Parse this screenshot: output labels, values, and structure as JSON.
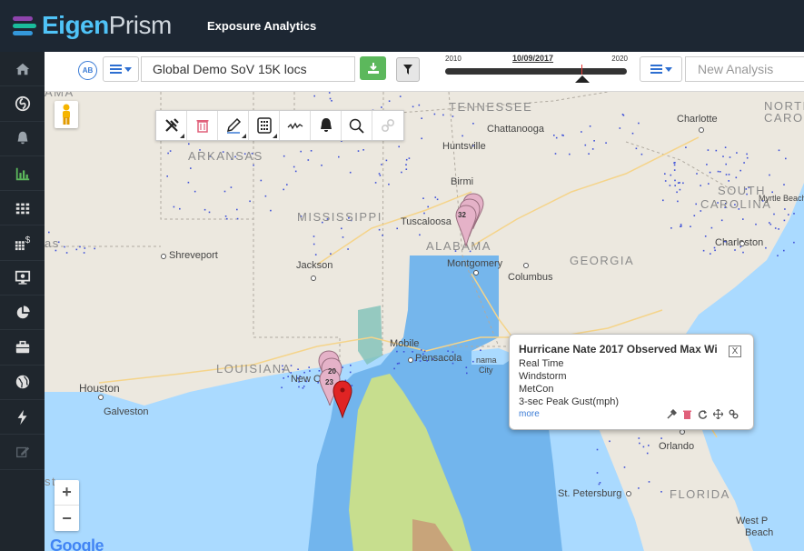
{
  "header": {
    "logo_part1": "Eigen",
    "logo_part2": "Prism",
    "app_title": "Exposure Analytics"
  },
  "sidebar": {
    "items": [
      {
        "icon": "home-icon"
      },
      {
        "icon": "hurricane-icon"
      },
      {
        "icon": "bell-icon"
      },
      {
        "icon": "bar-chart-icon"
      },
      {
        "icon": "grid-icon"
      },
      {
        "icon": "grid-dollar-icon"
      },
      {
        "icon": "monitor-chart-icon"
      },
      {
        "icon": "pie-chart-icon"
      },
      {
        "icon": "briefcase-icon"
      },
      {
        "icon": "globe-icon"
      },
      {
        "icon": "bolt-icon"
      },
      {
        "icon": "edit-icon"
      }
    ],
    "active_color": "#5cb85c",
    "icon_color": "#9aa3ab"
  },
  "toolbar": {
    "ab_label": "AB",
    "sov_name": "Global Demo SoV 15K locs",
    "timeline_start": "2010",
    "timeline_end": "2020",
    "timeline_date": "10/09/2017",
    "analysis_placeholder": "New Analysis"
  },
  "map": {
    "labels": {
      "tennessee": "TENNESSEE",
      "north_carolina_1": "NORTH",
      "north_carolina_2": "CAROLINA",
      "south_carolina_1": "SOUTH",
      "south_carolina_2": "CAROLINA",
      "arkansas": "ARKANSAS",
      "mississippi": "MISSISSIPPI",
      "alabama": "ALABAMA",
      "georgia": "GEORGIA",
      "louisiana": "LOUISIANA",
      "florida": "FLORIDA",
      "alabama_top": "AMA",
      "texas_edge": "as",
      "st_edge": "st"
    },
    "cities": {
      "charlotte": "Charlotte",
      "chattanooga": "Chattanooga",
      "huntsville": "Huntsville",
      "birmingham": "Birmi",
      "tuscaloosa": "Tuscaloosa",
      "myrtle_beach": "Myrtle Beach",
      "charleston": "Charleston",
      "shreveport": "Shreveport",
      "jackson": "Jackson",
      "montgomery": "Montgomery",
      "columbus": "Columbus",
      "mobile": "Mobile",
      "pensacola": "Pensacola",
      "panama_city": "City",
      "panama_city_prefix": "nama",
      "new_orleans": "New O",
      "houston": "Houston",
      "galveston": "Galveston",
      "orlando": "Orlando",
      "st_petersburg": "St. Petersburg",
      "west_palm_1": "West P",
      "west_palm_2": "Beach"
    },
    "clusters": [
      {
        "count": "32"
      },
      {
        "count": "20"
      },
      {
        "count": "23"
      }
    ],
    "google": "Google",
    "zoom_in": "+",
    "zoom_out": "−"
  },
  "drawtools": [
    {
      "icon": "tools-icon"
    },
    {
      "icon": "trash-icon"
    },
    {
      "icon": "pencil-icon"
    },
    {
      "icon": "calculator-icon"
    },
    {
      "icon": "line-chart-icon"
    },
    {
      "icon": "bell-icon"
    },
    {
      "icon": "search-icon"
    },
    {
      "icon": "link-icon"
    }
  ],
  "popup": {
    "title": "Hurricane Nate 2017 Observed Max Wi",
    "lines": [
      "Real Time",
      "Windstorm",
      "MetCon",
      "3-sec Peak Gust(mph)"
    ],
    "more": "more",
    "close": "X"
  }
}
